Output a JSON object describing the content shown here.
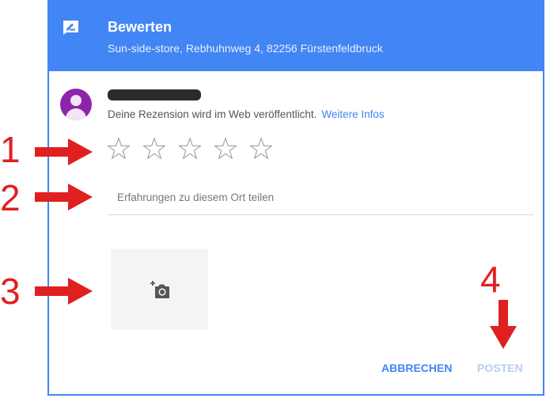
{
  "header": {
    "title": "Bewerten",
    "subtitle": "Sun-side-store, Rebhuhnweg 4, 82256 Fürstenfeldbruck",
    "icon": "rate-review-icon"
  },
  "colors": {
    "accent": "#4285f4",
    "annotation": "#e02020",
    "avatar": "#8e24aa"
  },
  "user": {
    "notice": "Deine Rezension wird im Web veröffentlicht.",
    "more_info_link": "Weitere Infos"
  },
  "rating": {
    "max": 5,
    "value": 0
  },
  "review": {
    "placeholder": "Erfahrungen zu diesem Ort teilen",
    "value": ""
  },
  "actions": {
    "cancel_label": "ABBRECHEN",
    "post_label": "POSTEN"
  },
  "annotations": [
    "1",
    "2",
    "3",
    "4"
  ]
}
